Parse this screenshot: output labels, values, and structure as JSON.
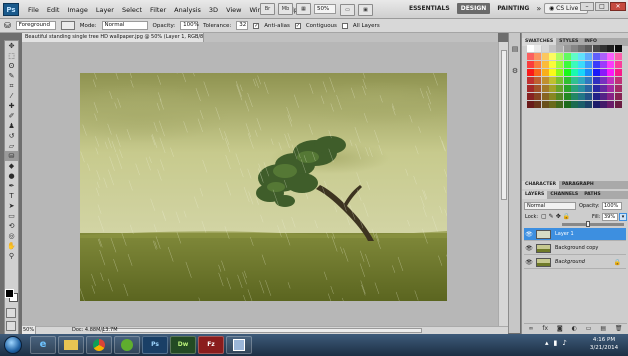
{
  "app": {
    "logo": "Ps"
  },
  "menu": [
    "File",
    "Edit",
    "Image",
    "Layer",
    "Select",
    "Filter",
    "Analysis",
    "3D",
    "View",
    "Window",
    "Help"
  ],
  "menubar": {
    "zoom": "50%",
    "workspaces": [
      "ESSENTIALS",
      "DESIGN",
      "PAINTING"
    ],
    "active_workspace": "DESIGN",
    "more": "»",
    "cslive": "CS Live"
  },
  "options": {
    "preset": "Foreground",
    "mode_label": "Mode:",
    "mode_value": "Normal",
    "opacity_label": "Opacity:",
    "opacity_value": "100%",
    "tolerance_label": "Tolerance:",
    "tolerance_value": "32",
    "antialias": "Anti-alias",
    "contiguous": "Contiguous",
    "all_layers": "All Layers"
  },
  "document": {
    "tab_title": "Beautiful standing single tree HD wallpaper.jpg @ 50% (Layer 1, RGB/8) * ×",
    "zoom": "50%",
    "doc_info": "Doc: 4.88M/13.7M"
  },
  "panels": {
    "top_tabs": [
      "SWATCHES",
      "STYLES",
      "INFO"
    ],
    "char_tabs": [
      "CHARACTER",
      "PARAGRAPH"
    ],
    "layer_tabs": [
      "LAYERS",
      "CHANNELS",
      "PATHS"
    ],
    "blend_mode": "Normal",
    "opacity_label": "Opacity:",
    "opacity_value": "100%",
    "lock_label": "Lock:",
    "fill_label": "Fill:",
    "fill_value": "39%",
    "layers": [
      {
        "name": "Layer 1",
        "selected": true
      },
      {
        "name": "Background copy",
        "selected": false
      },
      {
        "name": "Background",
        "selected": false,
        "locked": true
      }
    ]
  },
  "taskbar": {
    "apps": [
      "ie-icon",
      "folder-icon",
      "chrome-icon",
      "utorrent-icon",
      "photoshop-icon",
      "dreamweaver-icon",
      "filezilla-icon",
      "app-icon"
    ],
    "app_labels": [
      "",
      "",
      "",
      "",
      "Ps",
      "Dw",
      "Fz",
      ""
    ],
    "time": "4:16 PM",
    "date": "3/21/2014"
  },
  "colors": {
    "photoshop_blue": "#1a5a8c",
    "selection_blue": "#3d8fe0",
    "sky": "#c9cc8f",
    "grass": "#6f7a28"
  }
}
